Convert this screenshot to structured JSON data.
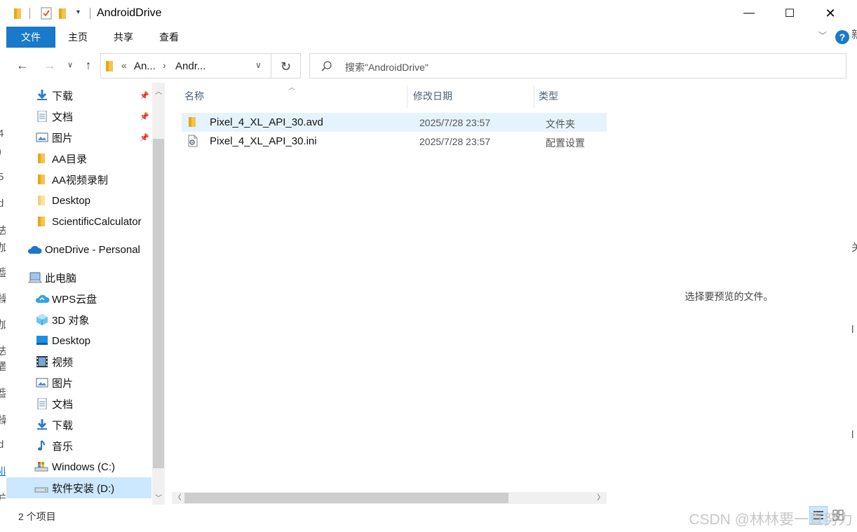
{
  "window": {
    "title": "AndroidDrive",
    "controls": {
      "minimize": "—",
      "maximize": "☐",
      "close": "✕"
    }
  },
  "ribbon": {
    "tabs": [
      {
        "label": "文件",
        "active": true
      },
      {
        "label": "主页"
      },
      {
        "label": "共享"
      },
      {
        "label": "查看"
      }
    ],
    "help": "?"
  },
  "address": {
    "breadcrumb_overflow": "«",
    "crumbs": [
      "An...",
      "Andr..."
    ],
    "separator": "›"
  },
  "search": {
    "placeholder": "搜索\"AndroidDrive\""
  },
  "nav_pane": {
    "quick_access": [
      {
        "label": "下载",
        "icon": "download-icon",
        "pinned": true
      },
      {
        "label": "文档",
        "icon": "document-icon",
        "pinned": true
      },
      {
        "label": "图片",
        "icon": "picture-icon",
        "pinned": true
      },
      {
        "label": "AA目录",
        "icon": "folder-icon"
      },
      {
        "label": "AA视频录制",
        "icon": "folder-icon"
      },
      {
        "label": "Desktop",
        "icon": "folder-light-icon"
      },
      {
        "label": "ScientificCalculator",
        "icon": "folder-icon"
      }
    ],
    "onedrive": {
      "label": "OneDrive - Personal",
      "icon": "cloud-icon"
    },
    "this_pc": {
      "label": "此电脑",
      "icon": "computer-icon"
    },
    "pc_items": [
      {
        "label": "WPS云盘",
        "icon": "wps-cloud-icon"
      },
      {
        "label": "3D 对象",
        "icon": "cube-icon"
      },
      {
        "label": "Desktop",
        "icon": "desktop-icon"
      },
      {
        "label": "视频",
        "icon": "video-icon"
      },
      {
        "label": "图片",
        "icon": "picture-icon"
      },
      {
        "label": "文档",
        "icon": "document-icon"
      },
      {
        "label": "下载",
        "icon": "download-icon"
      },
      {
        "label": "音乐",
        "icon": "music-icon"
      },
      {
        "label": "Windows  (C:)",
        "icon": "drive-c-icon"
      },
      {
        "label": "软件安装 (D:)",
        "icon": "drive-icon",
        "selected": true
      }
    ]
  },
  "file_list": {
    "columns": [
      "名称",
      "修改日期",
      "类型"
    ],
    "rows": [
      {
        "name": "Pixel_4_XL_API_30.avd",
        "date": "2025/7/28 23:57",
        "type": "文件夹",
        "icon": "folder-icon",
        "hover": true
      },
      {
        "name": "Pixel_4_XL_API_30.ini",
        "date": "2025/7/28 23:57",
        "type": "配置设置",
        "icon": "config-file-icon"
      }
    ]
  },
  "preview": {
    "message": "选择要预览的文件。"
  },
  "status": {
    "item_count": "2 个项目"
  },
  "watermark": "CSDN @林林要一直努力",
  "colors": {
    "accent": "#1979ca",
    "selected_bg": "#cce8ff",
    "hover_bg": "#e5f3ff",
    "folder": "#f4c54a"
  }
}
